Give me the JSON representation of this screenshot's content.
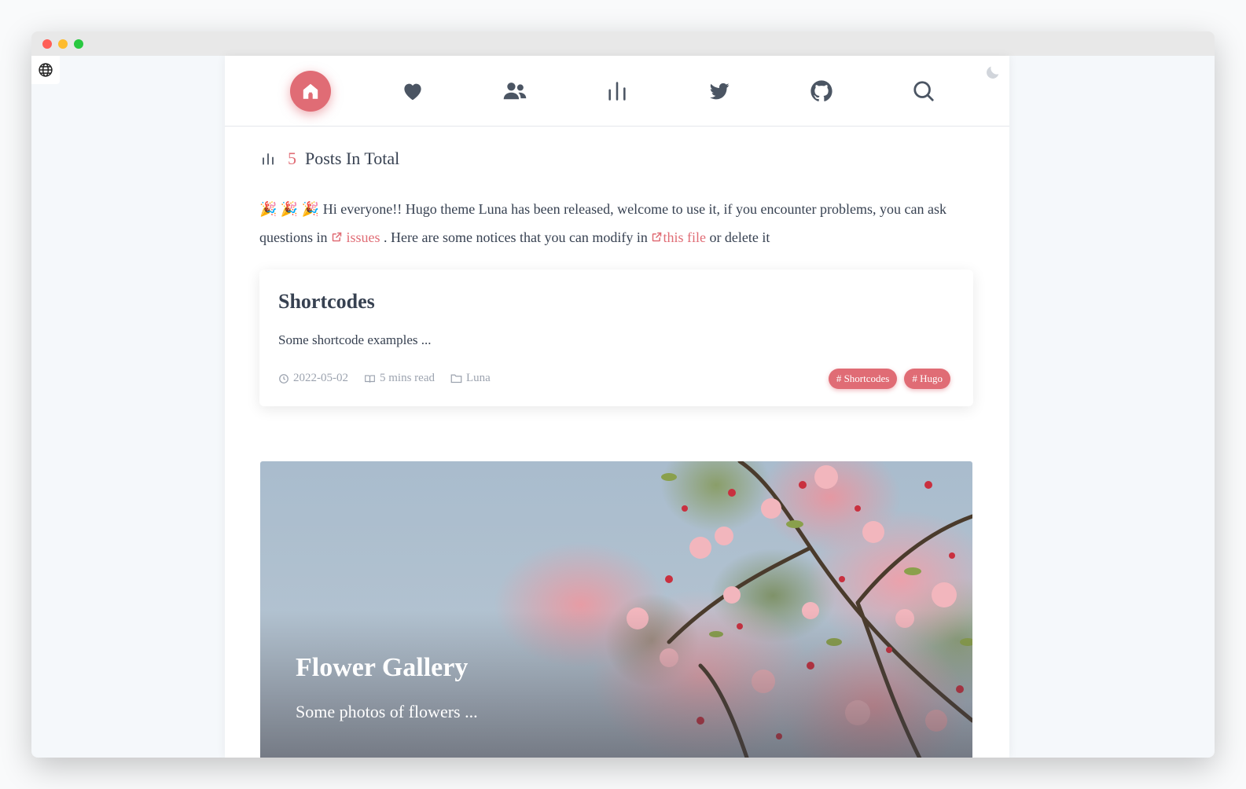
{
  "colors": {
    "accent": "#e06c75",
    "text": "#374151",
    "muted": "#9ca3af",
    "icon": "#4b5563"
  },
  "nav": {
    "items": [
      {
        "name": "home-icon",
        "active": true
      },
      {
        "name": "heart-icon",
        "active": false
      },
      {
        "name": "users-icon",
        "active": false
      },
      {
        "name": "bar-chart-icon",
        "active": false
      },
      {
        "name": "twitter-icon",
        "active": false
      },
      {
        "name": "github-icon",
        "active": false
      },
      {
        "name": "search-icon",
        "active": false
      }
    ]
  },
  "summary": {
    "count": "5",
    "label": "Posts In Total"
  },
  "notice": {
    "emoji": "🎉 🎉 🎉",
    "text1": "Hi everyone!! Hugo theme Luna has been released, welcome to use it, if you encounter problems, you can ask questions in",
    "link1": "issues",
    "text2": ". Here are some notices that you can modify in",
    "link2": "this file",
    "text3": "or delete it"
  },
  "posts": [
    {
      "title": "Shortcodes",
      "summary": "Some shortcode examples ...",
      "date": "2022-05-02",
      "read": "5 mins read",
      "category": "Luna",
      "tags": [
        "# Shortcodes",
        "# Hugo"
      ]
    },
    {
      "title": "Flower Gallery",
      "summary": "Some photos of flowers ..."
    }
  ]
}
